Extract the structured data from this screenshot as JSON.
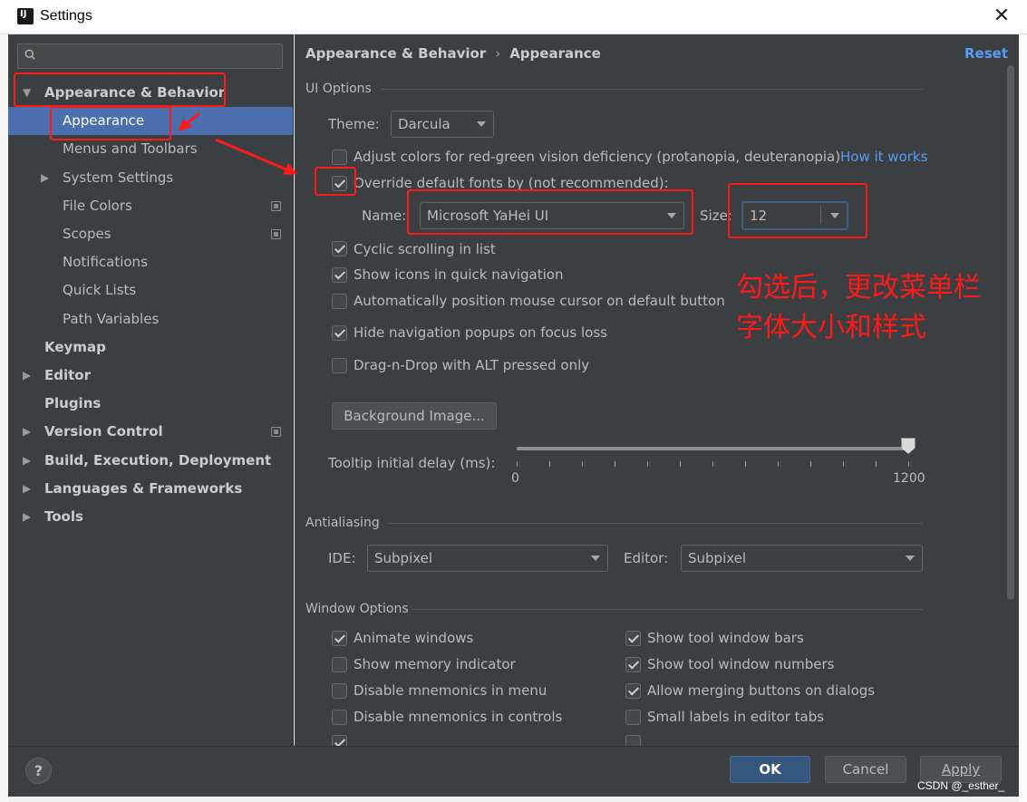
{
  "window": {
    "title": "Settings",
    "logo_text": "IJ"
  },
  "search": {
    "placeholder": ""
  },
  "sidebar": {
    "items": [
      {
        "label": "Appearance & Behavior",
        "level": 0,
        "expanded": true,
        "bold": true
      },
      {
        "label": "Appearance",
        "level": 1,
        "selected": true
      },
      {
        "label": "Menus and Toolbars",
        "level": 1
      },
      {
        "label": "System Settings",
        "level": 1,
        "collapsed": true
      },
      {
        "label": "File Colors",
        "level": 1,
        "project": true
      },
      {
        "label": "Scopes",
        "level": 1,
        "project": true
      },
      {
        "label": "Notifications",
        "level": 1
      },
      {
        "label": "Quick Lists",
        "level": 1
      },
      {
        "label": "Path Variables",
        "level": 1
      },
      {
        "label": "Keymap",
        "level": 0,
        "bold": true
      },
      {
        "label": "Editor",
        "level": 0,
        "bold": true,
        "collapsed": true
      },
      {
        "label": "Plugins",
        "level": 0,
        "bold": true
      },
      {
        "label": "Version Control",
        "level": 0,
        "bold": true,
        "collapsed": true,
        "project": true
      },
      {
        "label": "Build, Execution, Deployment",
        "level": 0,
        "bold": true,
        "collapsed": true
      },
      {
        "label": "Languages & Frameworks",
        "level": 0,
        "bold": true,
        "collapsed": true
      },
      {
        "label": "Tools",
        "level": 0,
        "bold": true,
        "collapsed": true
      }
    ]
  },
  "breadcrumb": {
    "parent": "Appearance & Behavior",
    "sep": "›",
    "current": "Appearance"
  },
  "reset_label": "Reset",
  "ui_options": {
    "title": "UI Options",
    "theme_label": "Theme:",
    "theme_value": "Darcula",
    "adjust_colors": {
      "label": "Adjust colors for red-green vision deficiency (protanopia, deuteranopia)",
      "checked": false
    },
    "how_it_works": "How it works",
    "override_fonts": {
      "label": "Override default fonts by (not recommended):",
      "checked": true
    },
    "name_label": "Name:",
    "font_name": "Microsoft YaHei UI",
    "size_label": "Size:",
    "font_size": "12",
    "cyclic": {
      "label": "Cyclic scrolling in list",
      "checked": true
    },
    "show_icons": {
      "label": "Show icons in quick navigation",
      "checked": true
    },
    "auto_cursor": {
      "label": "Automatically position mouse cursor on default button",
      "checked": false
    },
    "hide_nav": {
      "label": "Hide navigation popups on focus loss",
      "checked": true
    },
    "drag_drop": {
      "label": "Drag-n-Drop with ALT pressed only",
      "checked": false
    },
    "bg_image_button": "Background Image...",
    "tooltip_label": "Tooltip initial delay (ms):",
    "tooltip_min": "0",
    "tooltip_max": "1200",
    "tooltip_value": 1200
  },
  "antialiasing": {
    "title": "Antialiasing",
    "ide_label": "IDE:",
    "ide_value": "Subpixel",
    "editor_label": "Editor:",
    "editor_value": "Subpixel"
  },
  "window_options": {
    "title": "Window Options",
    "left": [
      {
        "label": "Animate windows",
        "checked": true
      },
      {
        "label": "Show memory indicator",
        "checked": false
      },
      {
        "label": "Disable mnemonics in menu",
        "checked": false
      },
      {
        "label": "Disable mnemonics in controls",
        "checked": false
      }
    ],
    "right": [
      {
        "label": "Show tool window bars",
        "checked": true
      },
      {
        "label": "Show tool window numbers",
        "checked": true
      },
      {
        "label": "Allow merging buttons on dialogs",
        "checked": true
      },
      {
        "label": "Small labels in editor tabs",
        "checked": false
      }
    ]
  },
  "footer": {
    "help": "?",
    "ok": "OK",
    "cancel": "Cancel",
    "apply": "Apply"
  },
  "annotation": {
    "text": "勾选后，更改菜单栏\n字体大小和样式",
    "color": "#ff1a1a"
  },
  "watermark": "CSDN @_esther_",
  "colors": {
    "accent": "#4b6eaf",
    "link": "#589df6",
    "background": "#3c3f41",
    "ok_button": "#365880",
    "annotation": "#ff1a1a"
  }
}
